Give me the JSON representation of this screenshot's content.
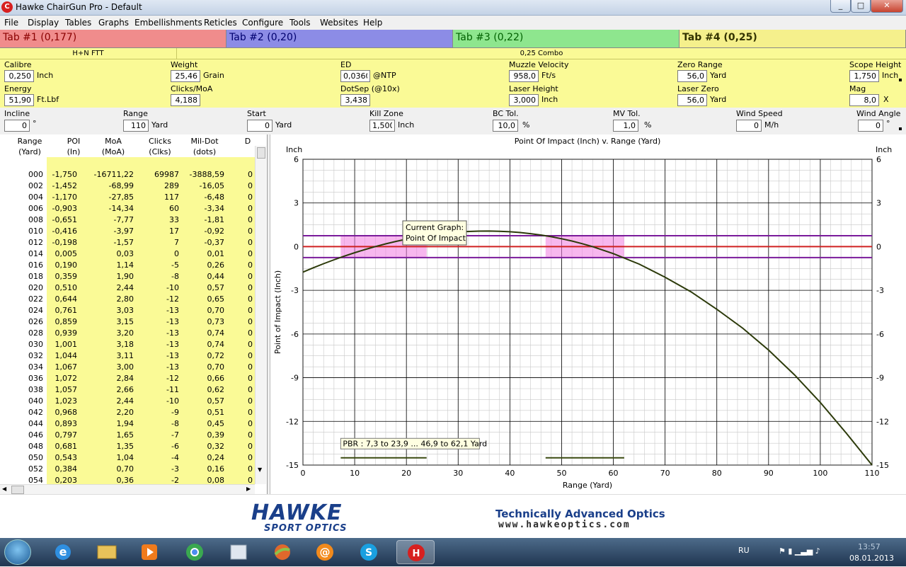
{
  "window": {
    "title": "Hawke ChairGun Pro - Default",
    "icon": "chairgun-app-icon"
  },
  "menu": [
    "File",
    "Display",
    "Tables",
    "Graphs",
    "Embellishments",
    "Reticles",
    "Configure",
    "Tools",
    "Websites",
    "Help"
  ],
  "tabs": [
    {
      "label": "Tab #1 (0,177)",
      "color": "#f08c8c"
    },
    {
      "label": "Tab #2 (0,20)",
      "color": "#8c8ce6"
    },
    {
      "label": "Tab #3 (0,22)",
      "color": "#8ee68e"
    },
    {
      "label": "Tab #4 (0,25)",
      "color": "#f5f08c"
    }
  ],
  "names": {
    "left": "H+N FTT",
    "right": "0,25 Combo"
  },
  "params": {
    "calibre": {
      "label": "Calibre",
      "value": "0,250",
      "unit": "Inch"
    },
    "weight": {
      "label": "Weight",
      "value": "25,46",
      "unit": "Grain"
    },
    "ed": {
      "label": "ED",
      "value": "0,0360",
      "unit": "@NTP"
    },
    "muzzle_velocity": {
      "label": "Muzzle Velocity",
      "value": "958,0",
      "unit": "Ft/s"
    },
    "zero_range": {
      "label": "Zero Range",
      "value": "56,0",
      "unit": "Yard"
    },
    "scope_height": {
      "label": "Scope Height",
      "value": "1,750",
      "unit": "Inch"
    },
    "energy": {
      "label": "Energy",
      "value": "51,90",
      "unit": "Ft.Lbf"
    },
    "clicks_moa": {
      "label": "Clicks/MoA",
      "value": "4,188",
      "unit": ""
    },
    "dotsep": {
      "label": "DotSep (@10x)",
      "value": "3,438",
      "unit": ""
    },
    "laser_height": {
      "label": "Laser Height",
      "value": "3,000",
      "unit": "Inch"
    },
    "laser_zero": {
      "label": "Laser Zero",
      "value": "56,0",
      "unit": "Yard"
    },
    "mag": {
      "label": "Mag",
      "value": "8,0",
      "unit": "X"
    },
    "incline": {
      "label": "Incline",
      "value": "0",
      "unit": "°"
    },
    "range": {
      "label": "Range",
      "value": "110",
      "unit": "Yard"
    },
    "start": {
      "label": "Start",
      "value": "0",
      "unit": "Yard"
    },
    "kill_zone": {
      "label": "Kill Zone",
      "value": "1,500",
      "unit": "Inch"
    },
    "bc_tol": {
      "label": "BC Tol.",
      "value": "10,0",
      "unit": "%"
    },
    "mv_tol": {
      "label": "MV Tol.",
      "value": "1,0",
      "unit": "%"
    },
    "wind_speed": {
      "label": "Wind Speed",
      "value": "0",
      "unit": "M/h"
    },
    "wind_angle": {
      "label": "Wind Angle",
      "value": "0",
      "unit": "°"
    }
  },
  "table": {
    "headers": [
      [
        "Range",
        "(Yard)"
      ],
      [
        "POI",
        "(In)"
      ],
      [
        "MoA",
        "(MoA)"
      ],
      [
        "Clicks",
        "(Clks)"
      ],
      [
        "Mil-Dot",
        "(dots)"
      ],
      [
        "D",
        ""
      ]
    ],
    "rows": [
      [
        "000",
        "-1,750",
        "-16711,22",
        "69987",
        "-3888,59",
        "0"
      ],
      [
        "002",
        "-1,452",
        "-68,99",
        "289",
        "-16,05",
        "0"
      ],
      [
        "004",
        "-1,170",
        "-27,85",
        "117",
        "-6,48",
        "0"
      ],
      [
        "006",
        "-0,903",
        "-14,34",
        "60",
        "-3,34",
        "0"
      ],
      [
        "008",
        "-0,651",
        "-7,77",
        "33",
        "-1,81",
        "0"
      ],
      [
        "010",
        "-0,416",
        "-3,97",
        "17",
        "-0,92",
        "0"
      ],
      [
        "012",
        "-0,198",
        "-1,57",
        "7",
        "-0,37",
        "0"
      ],
      [
        "014",
        "0,005",
        "0,03",
        "0",
        "0,01",
        "0"
      ],
      [
        "016",
        "0,190",
        "1,14",
        "-5",
        "0,26",
        "0"
      ],
      [
        "018",
        "0,359",
        "1,90",
        "-8",
        "0,44",
        "0"
      ],
      [
        "020",
        "0,510",
        "2,44",
        "-10",
        "0,57",
        "0"
      ],
      [
        "022",
        "0,644",
        "2,80",
        "-12",
        "0,65",
        "0"
      ],
      [
        "024",
        "0,761",
        "3,03",
        "-13",
        "0,70",
        "0"
      ],
      [
        "026",
        "0,859",
        "3,15",
        "-13",
        "0,73",
        "0"
      ],
      [
        "028",
        "0,939",
        "3,20",
        "-13",
        "0,74",
        "0"
      ],
      [
        "030",
        "1,001",
        "3,18",
        "-13",
        "0,74",
        "0"
      ],
      [
        "032",
        "1,044",
        "3,11",
        "-13",
        "0,72",
        "0"
      ],
      [
        "034",
        "1,067",
        "3,00",
        "-13",
        "0,70",
        "0"
      ],
      [
        "036",
        "1,072",
        "2,84",
        "-12",
        "0,66",
        "0"
      ],
      [
        "038",
        "1,057",
        "2,66",
        "-11",
        "0,62",
        "0"
      ],
      [
        "040",
        "1,023",
        "2,44",
        "-10",
        "0,57",
        "0"
      ],
      [
        "042",
        "0,968",
        "2,20",
        "-9",
        "0,51",
        "0"
      ],
      [
        "044",
        "0,893",
        "1,94",
        "-8",
        "0,45",
        "0"
      ],
      [
        "046",
        "0,797",
        "1,65",
        "-7",
        "0,39",
        "0"
      ],
      [
        "048",
        "0,681",
        "1,35",
        "-6",
        "0,32",
        "0"
      ],
      [
        "050",
        "0,543",
        "1,04",
        "-4",
        "0,24",
        "0"
      ],
      [
        "052",
        "0,384",
        "0,70",
        "-3",
        "0,16",
        "0"
      ],
      [
        "054",
        "0,203",
        "0,36",
        "-2",
        "0,08",
        "0"
      ]
    ]
  },
  "chart_data": {
    "type": "line",
    "title": "Point Of Impact (Inch) v. Range (Yard)",
    "xlabel": "Range (Yard)",
    "ylabel": "Point of Impact (Inch)",
    "unit_left": "Inch",
    "unit_right": "Inch",
    "xlim": [
      0,
      110
    ],
    "ylim": [
      -15,
      6
    ],
    "xticks": [
      0,
      10,
      20,
      30,
      40,
      50,
      60,
      70,
      80,
      90,
      100,
      110
    ],
    "yticks": [
      6,
      3,
      0,
      -3,
      -6,
      -9,
      -12,
      -15
    ],
    "grid": true,
    "series": [
      {
        "name": "Point Of Impact",
        "x": [
          0,
          2,
          4,
          6,
          8,
          10,
          12,
          14,
          16,
          18,
          20,
          22,
          24,
          26,
          28,
          30,
          32,
          34,
          36,
          38,
          40,
          42,
          44,
          46,
          48,
          50,
          52,
          54,
          56,
          60,
          65,
          70,
          75,
          80,
          85,
          90,
          95,
          100,
          105,
          110
        ],
        "y": [
          -1.75,
          -1.452,
          -1.17,
          -0.903,
          -0.651,
          -0.416,
          -0.198,
          0.005,
          0.19,
          0.359,
          0.51,
          0.644,
          0.761,
          0.859,
          0.939,
          1.001,
          1.044,
          1.067,
          1.072,
          1.057,
          1.023,
          0.968,
          0.893,
          0.797,
          0.681,
          0.543,
          0.384,
          0.203,
          0.0,
          -0.48,
          -1.2,
          -2.1,
          -3.1,
          -4.3,
          -5.6,
          -7.1,
          -8.8,
          -10.7,
          -12.8,
          -15.0
        ]
      }
    ],
    "kill_zone": {
      "upper": 0.75,
      "lower": -0.75
    },
    "pbr_ranges": [
      [
        7.3,
        23.9
      ],
      [
        46.9,
        62.1
      ]
    ],
    "tooltip": {
      "line1": "Current Graph:",
      "line2": "Point Of Impact"
    },
    "pbr_label": "PBR : 7,3 to 23,9 ... 46,9 to 62,1 Yard"
  },
  "footer": {
    "brand": "HAWKE",
    "brand_sub": "SPORT OPTICS",
    "tagline": "Technically Advanced Optics",
    "website": "www.hawkeoptics.com"
  },
  "taskbar": {
    "lang": "RU",
    "time": "13:57",
    "date": "08.01.2013",
    "items": [
      "start-button",
      "ie-icon",
      "explorer-icon",
      "media-player-icon",
      "chrome-icon",
      "app-icon-5",
      "app-icon-6",
      "mail-icon",
      "skype-icon",
      "chairgun-taskbar-icon"
    ]
  }
}
